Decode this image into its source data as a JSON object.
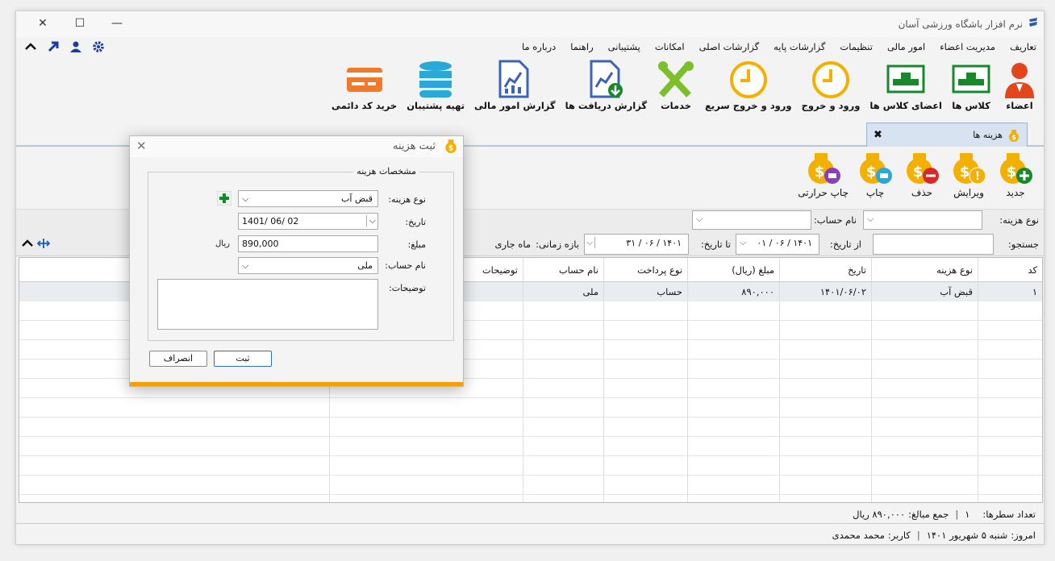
{
  "window": {
    "title": "نرم افزار باشگاه ورزشی آسان",
    "controls": [
      "✕",
      "☐",
      "—"
    ]
  },
  "menu": [
    "تعاریف",
    "مدیریت اعضاء",
    "امور مالی",
    "تنظیمات",
    "گزارشات پایه",
    "گزارشات اصلی",
    "امکانات",
    "پشتیبانی",
    "راهنما",
    "درباره ما"
  ],
  "ribbon": [
    {
      "label": "اعضاء",
      "icon": "member-icon"
    },
    {
      "label": "کلاس ها",
      "icon": "class-icon"
    },
    {
      "label": "اعضای کلاس ها",
      "icon": "class-members-icon"
    },
    {
      "label": "ورود و خروج",
      "icon": "clock-icon"
    },
    {
      "label": "ورود و خروج سریع",
      "icon": "quick-clock-icon"
    },
    {
      "label": "خدمات",
      "icon": "tools-icon"
    },
    {
      "label": "گزارش دریافت ها",
      "icon": "receipt-report-icon"
    },
    {
      "label": "گزارش امور مالی",
      "icon": "finance-report-icon"
    },
    {
      "label": "تهیه پشتیبان",
      "icon": "database-icon"
    },
    {
      "label": "خرید کد دائمی",
      "icon": "credit-card-icon"
    }
  ],
  "tab": {
    "label": "هزینه ها",
    "close": "x"
  },
  "toolbar": [
    {
      "label": "جدید",
      "icon": "add-icon"
    },
    {
      "label": "ویرایش",
      "icon": "edit-icon"
    },
    {
      "label": "حذف",
      "icon": "delete-icon"
    },
    {
      "label": "چاپ",
      "icon": "print-icon"
    },
    {
      "label": "چاپ حرارتی",
      "icon": "thermal-print-icon"
    }
  ],
  "filters": {
    "cost_type_label": "نوع هزینه:",
    "account_label": "نام حساب:",
    "search_label": "جستجو:",
    "from_label": "از تاریخ:",
    "from_value": "۱۴۰۱ / ۰۶ / ۰۱",
    "to_label": "تا تاریخ:",
    "to_value": "۱۴۰۱ / ۰۶ / ۳۱",
    "period_label": "بازه زمانی:",
    "period_value": "ماه جاری"
  },
  "grid": {
    "headers": [
      "کد",
      "نوع هزینه",
      "تاریخ",
      "مبلغ (ریال)",
      "نوع پرداخت",
      "نام حساب",
      "توضیحات"
    ],
    "rows": [
      [
        "۱",
        "قبض آب",
        "۱۴۰۱/۰۶/۰۲",
        "۸۹۰,۰۰۰",
        "حساب",
        "ملی",
        ""
      ]
    ]
  },
  "status": {
    "row_count_label": "تعداد سطرها:",
    "row_count": "۱",
    "sum_label": "جمع مبالغ:",
    "sum_value": "۸۹۰,۰۰۰ ریال",
    "today_label": "امروز:",
    "today_value": "شنبه ۵ شهریور ۱۴۰۱",
    "user_label": "کاربر:",
    "user_value": "محمد محمدی"
  },
  "dialog": {
    "title": "ثبت هزینه",
    "group_title": "مشخصات هزینه",
    "cost_type_label": "نوع هزینه:",
    "cost_type_value": "قبض آب",
    "date_label": "تاریخ:",
    "date_value": "1401/ 06/ 02",
    "amount_label": "مبلغ:",
    "amount_value": "890,000",
    "currency": "ریال",
    "account_label": "نام حساب:",
    "account_value": "ملی",
    "desc_label": "توضیحات:",
    "save": "ثبت",
    "cancel": "انصراف"
  }
}
